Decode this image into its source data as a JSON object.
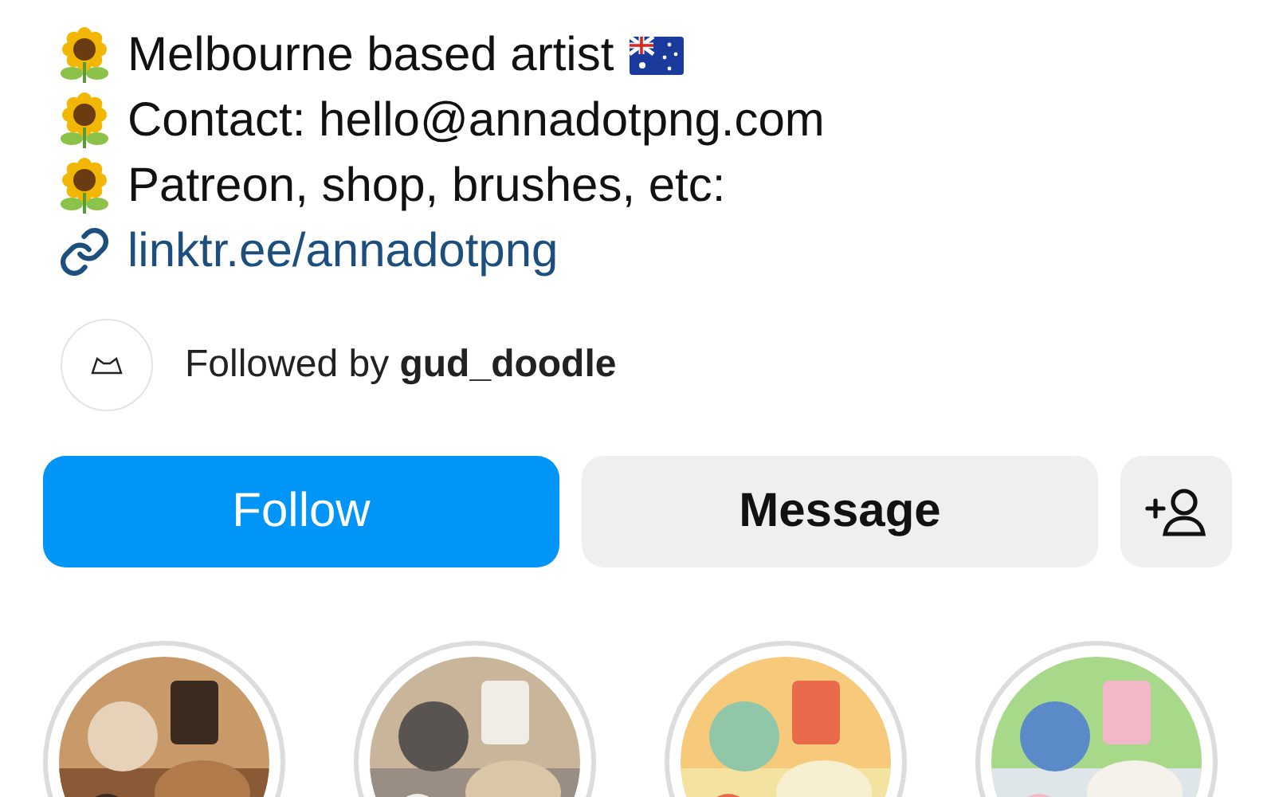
{
  "bio": [
    {
      "kind": "bullet",
      "text": "Melbourne based artist",
      "flag": true
    },
    {
      "kind": "bullet",
      "text": "Contact: hello@annadotpng.com",
      "flag": false
    },
    {
      "kind": "bullet",
      "text": "Patreon, shop, brushes, etc:",
      "flag": false
    },
    {
      "kind": "link",
      "text": "linktr.ee/annadotpng",
      "flag": false
    }
  ],
  "followed_by": {
    "prefix": "Followed by",
    "username": "gud_doodle"
  },
  "buttons": [
    {
      "kind": "primary",
      "label": "Follow"
    },
    {
      "kind": "secondary",
      "label": "Message"
    },
    {
      "kind": "add_person"
    }
  ]
}
